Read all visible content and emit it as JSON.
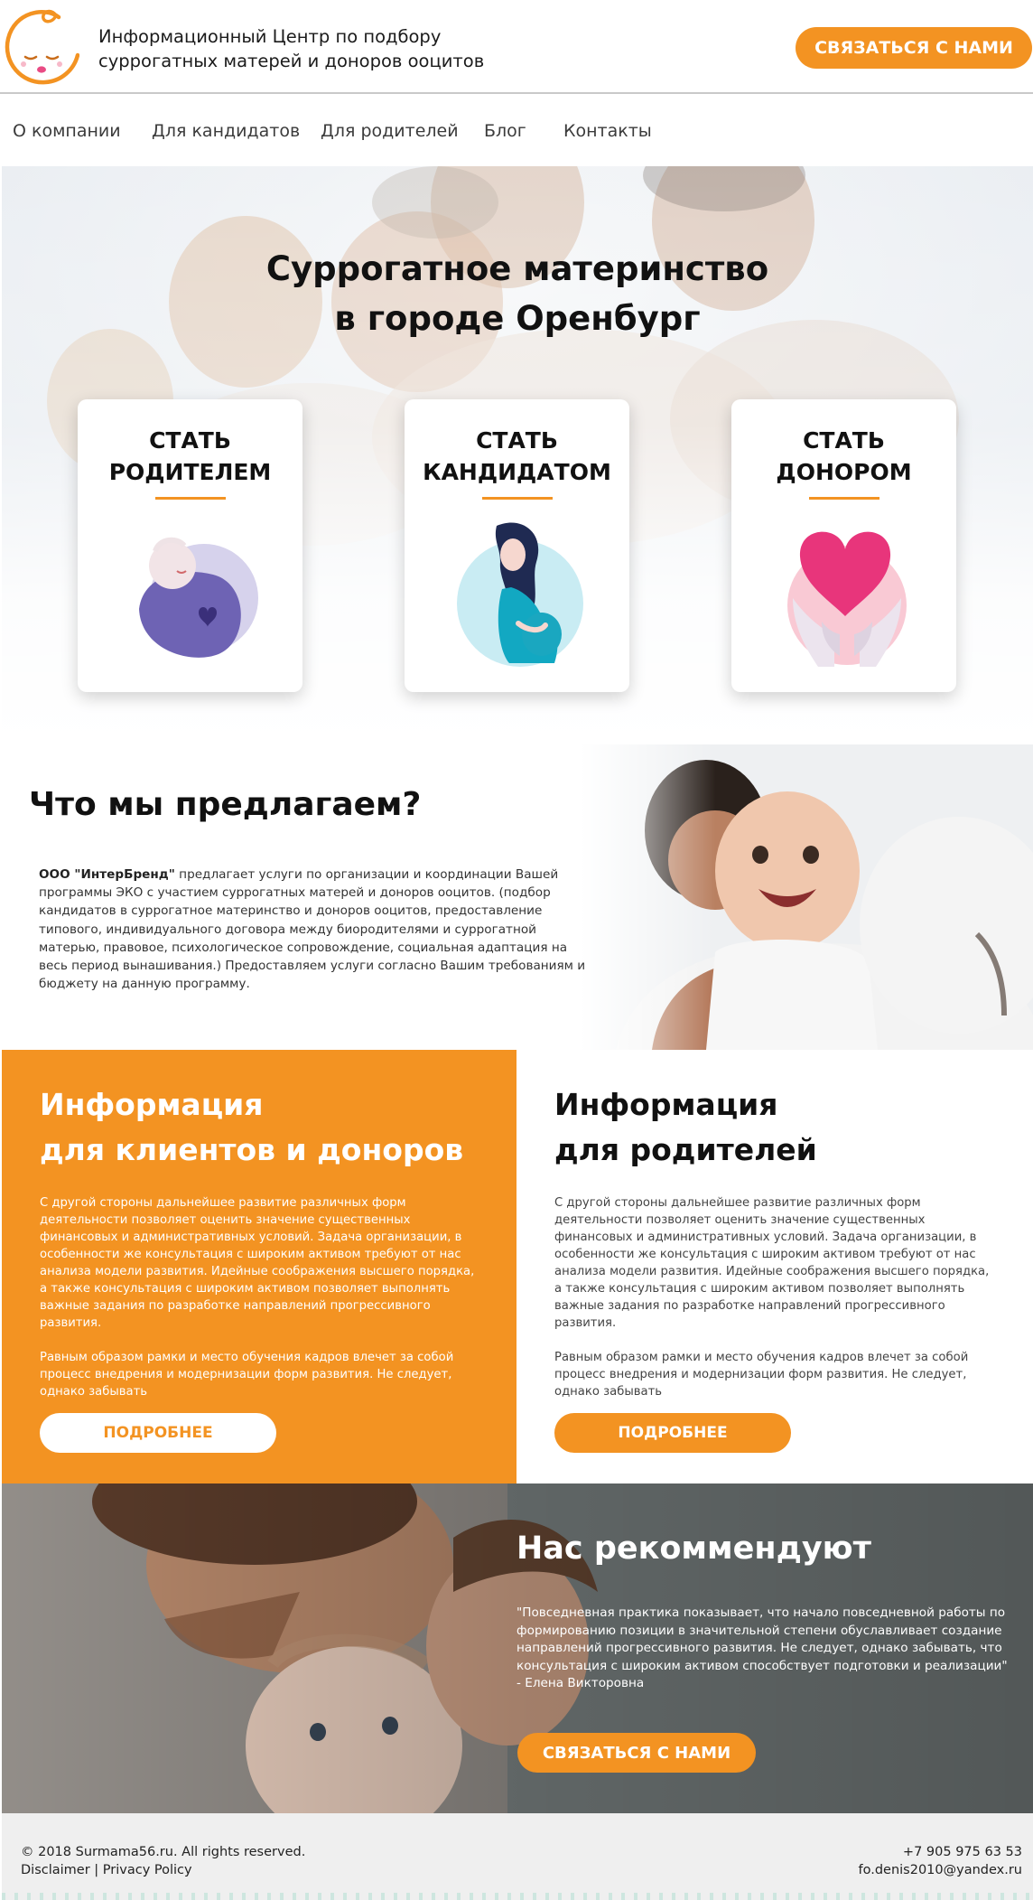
{
  "header": {
    "brand_line1": "Информационный Центр по подбору",
    "brand_line2": "суррогатных матерей и доноров ооцитов",
    "cta_label": "СВЯЗАТЬСЯ С НАМИ",
    "accent_color": "#f39322"
  },
  "nav": {
    "items": [
      {
        "label": "О компании"
      },
      {
        "label": "Для кандидатов"
      },
      {
        "label": "Для родителей"
      },
      {
        "label": "Блог"
      },
      {
        "label": "Контакты"
      }
    ]
  },
  "hero": {
    "title_line1": "Суррогатное материнство",
    "title_line2": "в городе Оренбург",
    "cards": [
      {
        "line1": "СТАТЬ",
        "line2": "РОДИТЕЛЕМ",
        "icon": "sleeping-baby-icon"
      },
      {
        "line1": "СТАТЬ",
        "line2": "КАНДИДАТОМ",
        "icon": "pregnant-woman-icon"
      },
      {
        "line1": "СТАТЬ",
        "line2": "ДОНОРОМ",
        "icon": "heart-in-hands-icon"
      }
    ]
  },
  "offer": {
    "title": "Что мы предлагаем?",
    "company": "ООО \"ИнтерБренд\"",
    "text": " предлагает услуги по организации и координации Вашей программы ЭКО с участием суррогатных матерей и доноров ооцитов. (подбор кандидатов в суррогатное материнство и доноров ооцитов, предоставление типового, индивидуального договора между биородителями и суррогатной матерью, правовое,  психологическое сопровождение, социальная адаптация на весь период вынашивания.) Предоставляем услуги согласно Вашим требованиям и бюджету на данную программу."
  },
  "info": {
    "left": {
      "title_line1": "Информация",
      "title_line2": "для клиентов и доноров",
      "para1": "С другой стороны дальнейшее развитие различных форм деятельности позволяет оценить значение существенных финансовых и административных условий. Задача организации, в особенности же консультация с широким активом требуют от нас анализа модели развития. Идейные соображения высшего порядка, а также консультация с широким активом позволяет выполнять важные задания по разработке направлений прогрессивного развития.",
      "para2": "Равным образом рамки и место обучения кадров влечет за собой процесс внедрения и модернизации форм развития. Не следует, однако забывать",
      "button": "ПОДРОБНЕЕ"
    },
    "right": {
      "title_line1": "Информация",
      "title_line2": "для родителей",
      "para1": "С другой стороны дальнейшее развитие различных форм деятельности позволяет оценить значение существенных финансовых и административных условий. Задача организации, в особенности же консультация с широким активом требуют от нас анализа модели развития. Идейные соображения высшего порядка, а также консультация с широким активом позволяет выполнять важные задания по разработке направлений прогрессивного развития.",
      "para2": "Равным образом рамки и место обучения кадров влечет за собой процесс внедрения и модернизации форм развития. Не следует, однако забывать",
      "button": "ПОДРОБНЕЕ"
    }
  },
  "recommend": {
    "title": "Нас рекоммендуют",
    "quote": "\"Повседневная практика показывает, что начало повседневной работы по формированию позиции в значительной степени обуславливает создание направлений прогрессивного развития. Не следует, однако забывать, что консультация с широким активом способствует подготовки и реализации\" - Елена Викторовна",
    "button": "СВЯЗАТЬСЯ С НАМИ"
  },
  "footer": {
    "copyright": "© 2018 Surmama56.ru. All rights reserved.",
    "links": "Disclaimer | Privacy Policy",
    "phone": "+7 905 975 63 53",
    "email": "fo.denis2010@yandex.ru"
  }
}
